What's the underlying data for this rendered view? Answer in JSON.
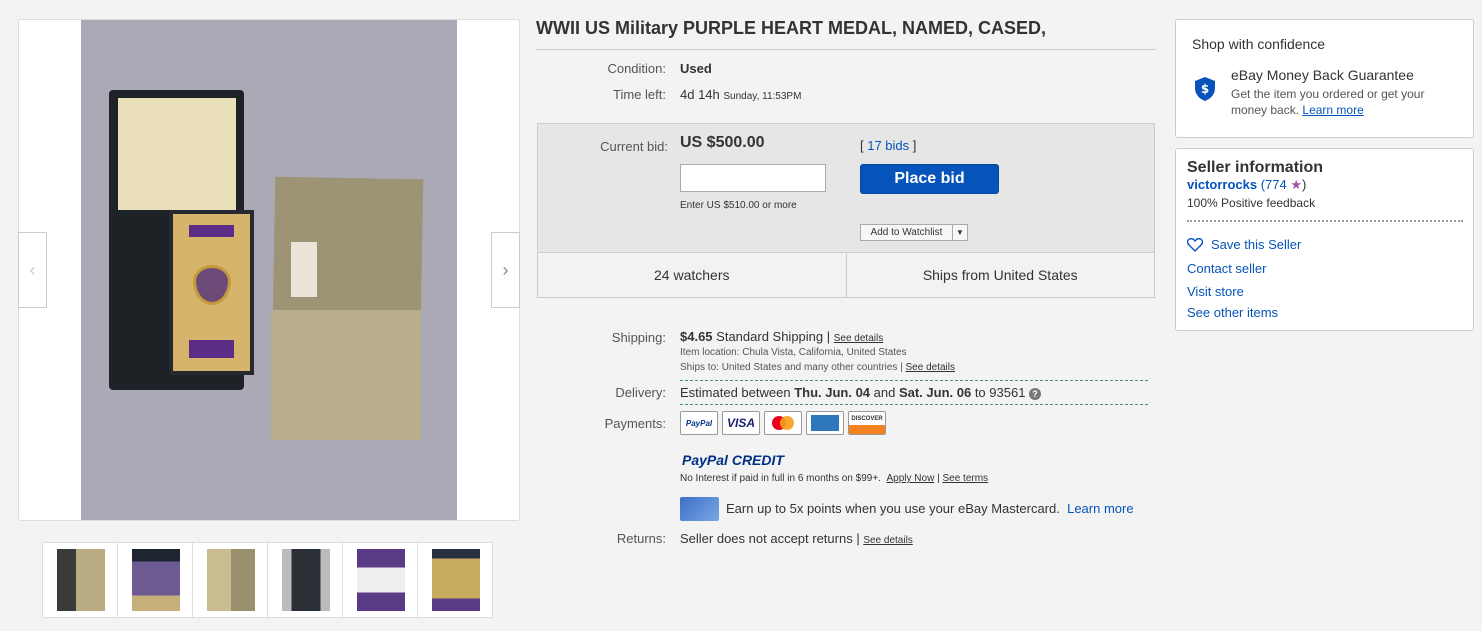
{
  "listing": {
    "title": "WWII US Military PURPLE HEART MEDAL, NAMED, CASED,",
    "condition_label": "Condition:",
    "condition_value": "Used",
    "time_left_label": "Time left:",
    "time_left_value": "4d 14h",
    "time_left_end": "Sunday, 11:53PM"
  },
  "gallery": {
    "prev_arrow": "‹",
    "next_arrow": "›",
    "thumbnail_count": 6
  },
  "bid": {
    "current_bid_label": "Current bid:",
    "current_bid_value": "US $500.00",
    "bids_open": "[ ",
    "bids_count": "17 bids",
    "bids_close": " ]",
    "input_value": "",
    "hint": "Enter US $510.00 or more",
    "place_bid_label": "Place bid",
    "watchlist_label": "Add to Watchlist",
    "watchers": "24 watchers",
    "ships_from": "Ships from United States"
  },
  "shipping": {
    "label": "Shipping:",
    "price": "$4.65",
    "method": " Standard Shipping | ",
    "details_link": "See details",
    "location": "Item location:  Chula Vista, California, United States",
    "ships_to": "Ships to:  United States and many other countries | ",
    "ships_to_link": "See details"
  },
  "delivery": {
    "label": "Delivery:",
    "pre": "Estimated between ",
    "start": "Thu. Jun. 04",
    "mid": " and ",
    "end": "Sat. Jun. 06",
    "post": " to 93561 ",
    "help_icon": "?"
  },
  "payments": {
    "label": "Payments:",
    "cards": [
      "PayPal",
      "VISA",
      "",
      "",
      "DISCOVER"
    ],
    "ppcredit_1": "PayPal",
    "ppcredit_2": " CREDIT",
    "no_interest": "No Interest if paid in full in 6 months on $99+.",
    "apply_now": "Apply Now",
    "separator": " | ",
    "see_terms": "See terms",
    "mastercard_text": "Earn up to 5x points when you use your eBay Mastercard.",
    "learn_more": "Learn more"
  },
  "returns": {
    "label": "Returns:",
    "text": "Seller does not accept returns | ",
    "details_link": "See details"
  },
  "confidence": {
    "title": "Shop with confidence",
    "mbg_title": "eBay Money Back Guarantee",
    "mbg_text": "Get the item you ordered or get your money back.",
    "learn_more": "Learn more"
  },
  "seller": {
    "title": "Seller information",
    "name": "victorrocks",
    "score": " (774 ",
    "star": "★",
    "score_close": ")",
    "feedback": "100% Positive feedback",
    "save": "Save this Seller",
    "contact": "Contact seller",
    "store": "Visit store",
    "other": "See other items"
  },
  "colors": {
    "link": "#0654ba",
    "place_bid": "#0654ba",
    "star": "#a34ea8"
  }
}
